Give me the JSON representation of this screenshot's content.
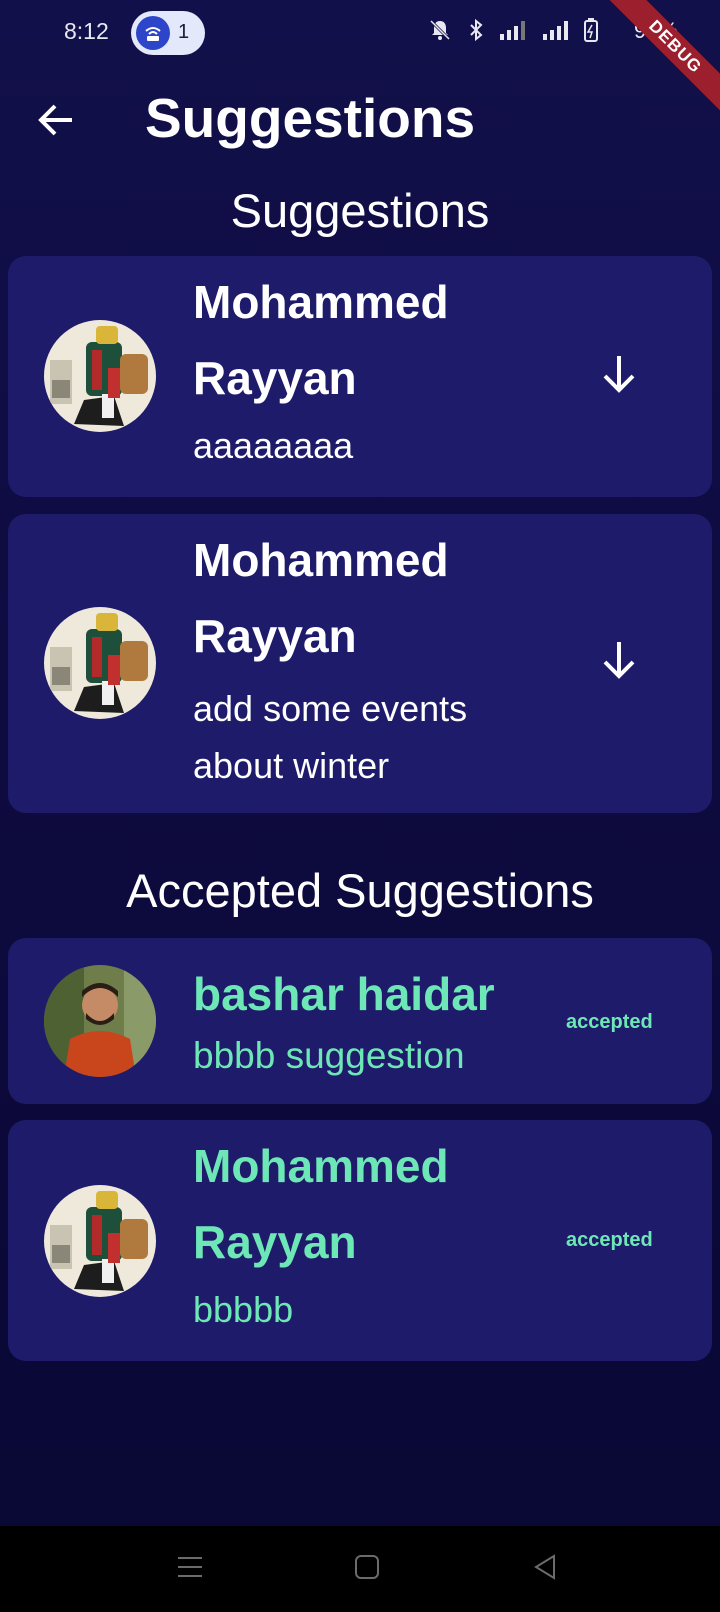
{
  "status_bar": {
    "time": "8:12",
    "notification_count": "1",
    "battery": "96%",
    "debug_banner": "DEBUG",
    "icons": [
      "hotspot-icon",
      "mute-icon",
      "bluetooth-icon",
      "signal-icon",
      "signal-icon",
      "battery-icon"
    ]
  },
  "app_bar": {
    "title": "Suggestions",
    "back_icon": "arrow-left-icon"
  },
  "suggestions": {
    "heading": "Suggestions",
    "items": [
      {
        "name": "Mohammed Rayyan",
        "message": "aaaaaaaa",
        "action_icon": "arrow-down-icon"
      },
      {
        "name": "Mohammed Rayyan",
        "message": "add some events about winter",
        "action_icon": "arrow-down-icon"
      }
    ]
  },
  "accepted": {
    "heading": "Accepted Suggestions",
    "items": [
      {
        "name": "bashar haidar",
        "message": "bbbb suggestion",
        "status": "accepted"
      },
      {
        "name": "Mohammed Rayyan",
        "message": "bbbbb",
        "status": "accepted"
      }
    ]
  },
  "nav_bar": {
    "icons": [
      "menu-icon",
      "home-icon",
      "back-icon"
    ]
  },
  "colors": {
    "background": "#12104a",
    "card": "#1f1b6b",
    "accent_green": "#6ee7b7",
    "pill": "#e4e8fb"
  }
}
